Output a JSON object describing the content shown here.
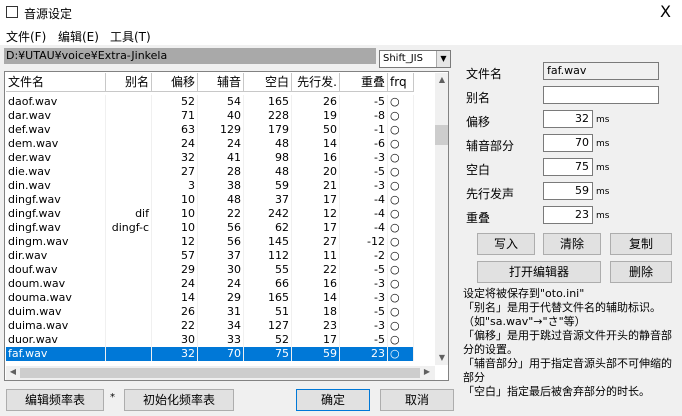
{
  "window": {
    "title": "音源设定",
    "close": "X"
  },
  "menu": [
    "文件(F)",
    "编辑(E)",
    "工具(T)"
  ],
  "path": "D:¥UTAU¥voice¥Extra-Jinkela",
  "encoding": "Shift_JIS",
  "table": {
    "headers": [
      "文件名",
      "别名",
      "偏移",
      "辅音",
      "空白",
      "先行发.",
      "重叠",
      "frq"
    ],
    "rows": [
      [
        "daof.wav",
        "",
        "52",
        "54",
        "165",
        "26",
        "-5",
        "○"
      ],
      [
        "dar.wav",
        "",
        "71",
        "40",
        "228",
        "19",
        "-8",
        "○"
      ],
      [
        "def.wav",
        "",
        "63",
        "129",
        "179",
        "50",
        "-1",
        "○"
      ],
      [
        "dem.wav",
        "",
        "24",
        "24",
        "48",
        "14",
        "-6",
        "○"
      ],
      [
        "der.wav",
        "",
        "32",
        "41",
        "98",
        "16",
        "-3",
        "○"
      ],
      [
        "die.wav",
        "",
        "27",
        "28",
        "48",
        "20",
        "-5",
        "○"
      ],
      [
        "din.wav",
        "",
        "3",
        "38",
        "59",
        "21",
        "-3",
        "○"
      ],
      [
        "dingf.wav",
        "",
        "10",
        "48",
        "37",
        "17",
        "-4",
        "○"
      ],
      [
        "dingf.wav",
        "dif",
        "10",
        "22",
        "242",
        "12",
        "-4",
        "○"
      ],
      [
        "dingf.wav",
        "dingf-c",
        "10",
        "56",
        "62",
        "17",
        "-4",
        "○"
      ],
      [
        "dingm.wav",
        "",
        "12",
        "56",
        "145",
        "27",
        "-12",
        "○"
      ],
      [
        "dir.wav",
        "",
        "57",
        "37",
        "112",
        "11",
        "-2",
        "○"
      ],
      [
        "douf.wav",
        "",
        "29",
        "30",
        "55",
        "22",
        "-5",
        "○"
      ],
      [
        "doum.wav",
        "",
        "24",
        "24",
        "66",
        "16",
        "-3",
        "○"
      ],
      [
        "douma.wav",
        "",
        "14",
        "29",
        "165",
        "14",
        "-3",
        "○"
      ],
      [
        "duim.wav",
        "",
        "26",
        "31",
        "51",
        "18",
        "-5",
        "○"
      ],
      [
        "duima.wav",
        "",
        "22",
        "34",
        "127",
        "23",
        "-3",
        "○"
      ],
      [
        "duor.wav",
        "",
        "30",
        "33",
        "52",
        "17",
        "-5",
        "○"
      ],
      [
        "faf.wav",
        "",
        "32",
        "70",
        "75",
        "59",
        "23",
        "○"
      ]
    ],
    "selected_index": 18
  },
  "fields": {
    "filename_label": "文件名",
    "filename_value": "faf.wav",
    "alias_label": "别名",
    "alias_value": "",
    "offset_label": "偏移",
    "offset_value": "32",
    "consonant_label": "辅音部分",
    "consonant_value": "70",
    "blank_label": "空白",
    "blank_value": "75",
    "preutter_label": "先行发声",
    "preutter_value": "59",
    "overlap_label": "重叠",
    "overlap_value": "23",
    "unit": "ms"
  },
  "buttons": {
    "write": "写入",
    "clear": "清除",
    "copy": "复制",
    "open_editor": "打开编辑器",
    "delete": "删除",
    "edit_freq": "编辑频率表",
    "star": "*",
    "init_freq": "初始化频率表",
    "ok": "确定",
    "cancel": "取消"
  },
  "help_lines": [
    "设定将被保存到\"oto.ini\"",
    "「别名」是用于代替文件名的辅助标识。（如\"sa.wav\"→\"さ\"等）",
    "「偏移」是用于跳过音源文件开头的静音部分的设置。",
    "「辅音部分」用于指定音源头部不可伸缩的部分",
    "「空白」指定最后被舍弃部分的时长。"
  ]
}
